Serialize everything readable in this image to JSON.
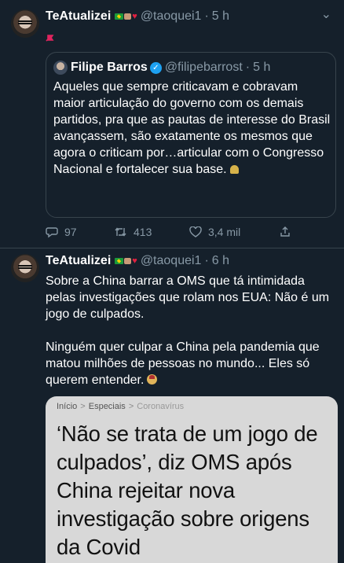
{
  "tweets": [
    {
      "name": "TeAtualizei",
      "handle": "@taoquei1",
      "time": "5 h",
      "quote": {
        "name": "Filipe Barros",
        "handle": "@filipebarrost",
        "time": "5 h",
        "text": "Aqueles que sempre criticavam e cobravam maior articulação do governo com os demais partidos, pra que as pautas de interesse do Brasil avançassem, são exatamente os mesmos que agora o criticam por…articular com o Congresso Nacional e fortalecer sua base."
      },
      "replies": "97",
      "retweets": "413",
      "likes": "3,4 mil"
    },
    {
      "name": "TeAtualizei",
      "handle": "@taoquei1",
      "time": "6 h",
      "text_p1": "Sobre a China barrar a OMS que tá intimidada pelas investigações que rolam nos EUA: Não é um jogo de culpados.",
      "text_p2": "Ninguém quer culpar a China pela pandemia que matou milhões de pessoas no mundo... Eles só querem entender.",
      "card": {
        "crumbs": [
          "Início",
          "Especiais",
          "Coronavírus"
        ],
        "title": "‘Não se trata de um jogo de culpados’, diz OMS após China rejeitar nova investigação sobre origens da Covid"
      }
    }
  ],
  "separator": "·",
  "crumb_sep": ">",
  "colors": {
    "background": "#15202b",
    "muted": "#8899a6",
    "border": "#38444d",
    "verified": "#1da1f2"
  }
}
